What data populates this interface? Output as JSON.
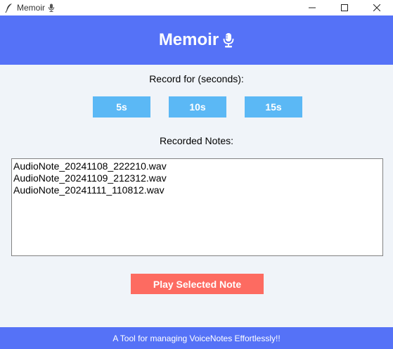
{
  "window": {
    "title": "Memoir",
    "controls": {
      "minimize": "—",
      "maximize": "☐",
      "close": "✕"
    }
  },
  "header": {
    "title": "Memoir",
    "icon": "microphone-icon"
  },
  "record": {
    "label": "Record for (seconds):",
    "buttons": [
      "5s",
      "10s",
      "15s"
    ]
  },
  "notes": {
    "label": "Recorded Notes:",
    "items": [
      "AudioNote_20241108_222210.wav",
      "AudioNote_20241109_212312.wav",
      "AudioNote_20241111_110812.wav"
    ]
  },
  "play_button": "Play Selected Note",
  "footer": "A Tool for managing VoiceNotes Effortlessly!!",
  "colors": {
    "header_bg": "#5572f7",
    "duration_button": "#5bb8f5",
    "play_button": "#fd6b61",
    "background": "#f0f4f9"
  }
}
